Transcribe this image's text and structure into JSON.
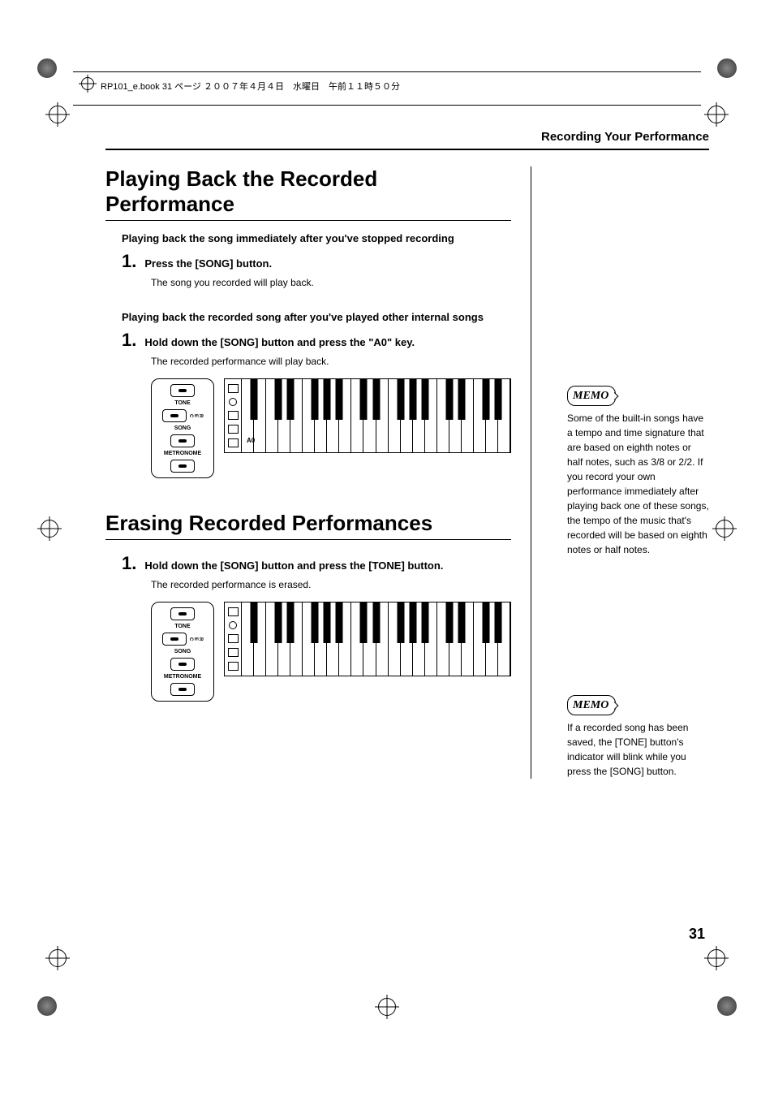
{
  "header": {
    "filename_line": "RP101_e.book 31 ページ ２００７年４月４日　水曜日　午前１１時５０分"
  },
  "breadcrumb": "Recording Your Performance",
  "sections": {
    "playback": {
      "title": "Playing Back the Recorded Performance",
      "sub1": "Playing back the song immediately after you've stopped recording",
      "step1_num": "1.",
      "step1_text": "Press the [SONG] button.",
      "step1_body": "The song you recorded will play back.",
      "sub2": "Playing back the recorded song after you've played other internal songs",
      "step2_num": "1.",
      "step2_text": "Hold down the [SONG] button and press the \"A0\" key.",
      "step2_body": "The recorded performance will play back."
    },
    "erase": {
      "title": "Erasing Recorded Performances",
      "step1_num": "1.",
      "step1_text": "Hold down the [SONG] button and press the [TONE] button.",
      "step1_body": "The recorded performance is erased."
    }
  },
  "diagram_labels": {
    "tone": "TONE",
    "song": "SONG",
    "metronome": "METRONOME",
    "rec": "REC",
    "a0": "A0"
  },
  "memos": {
    "memo_label": "MEMO",
    "memo1": "Some of the built-in songs have a tempo and time signature that are based on eighth notes or half notes, such as 3/8 or 2/2. If you record your own performance immediately after playing back one of these songs, the tempo of the music that's recorded will be based on eighth notes or half notes.",
    "memo2": "If a recorded song has been saved, the [TONE] button's indicator will blink while you press the [SONG] button."
  },
  "page_number": "31"
}
